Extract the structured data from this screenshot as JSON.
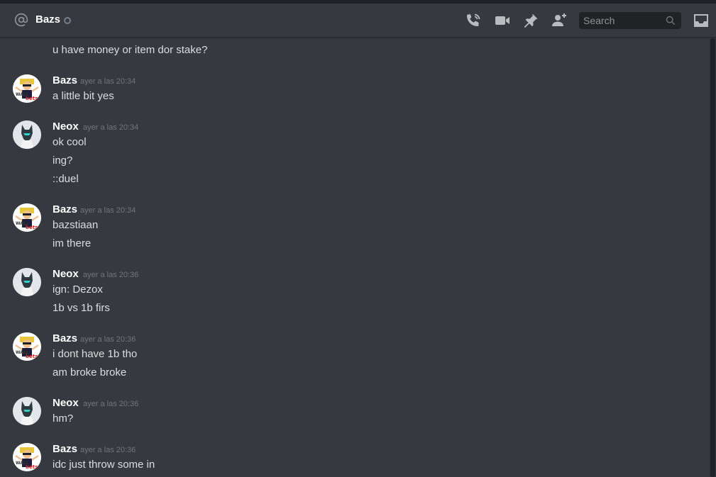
{
  "header": {
    "dm_name": "Bazs",
    "search_placeholder": "Search",
    "icons": [
      "at-icon",
      "phone-call-icon",
      "video-call-icon",
      "pin-icon",
      "add-user-icon",
      "search-icon",
      "inbox-icon"
    ],
    "status_color": "#747f8d"
  },
  "colors": {
    "background": "#36393f",
    "header_text": "#ffffff",
    "message_text": "#dcddde",
    "timestamp": "#72767d",
    "search_bg": "#202225"
  },
  "messages": {
    "orphan": "u have money or item dor stake?",
    "g1": {
      "author": "Bazs",
      "time": "ayer a las 20:34",
      "lines": [
        "a little bit yes"
      ]
    },
    "g2": {
      "author": "Neox",
      "time": "ayer a las 20:34",
      "lines": [
        "ok cool",
        "ing?",
        "::duel"
      ]
    },
    "g3": {
      "author": "Bazs",
      "time": "ayer a las 20:34",
      "lines": [
        "bazstiaan",
        "im there"
      ]
    },
    "g4": {
      "author": "Neox",
      "time": "ayer a las 20:36",
      "lines": [
        "ign: Dezox",
        "1b vs 1b firs"
      ]
    },
    "g5": {
      "author": "Bazs",
      "time": "ayer a las 20:36",
      "lines": [
        "i dont have 1b tho",
        "am broke broke"
      ]
    },
    "g6": {
      "author": "Neox",
      "time": "ayer a las 20:36",
      "lines": [
        "hm?"
      ]
    },
    "g7": {
      "author": "Bazs",
      "time": "ayer a las 20:36",
      "lines": [
        "idc just throw some in"
      ]
    }
  }
}
